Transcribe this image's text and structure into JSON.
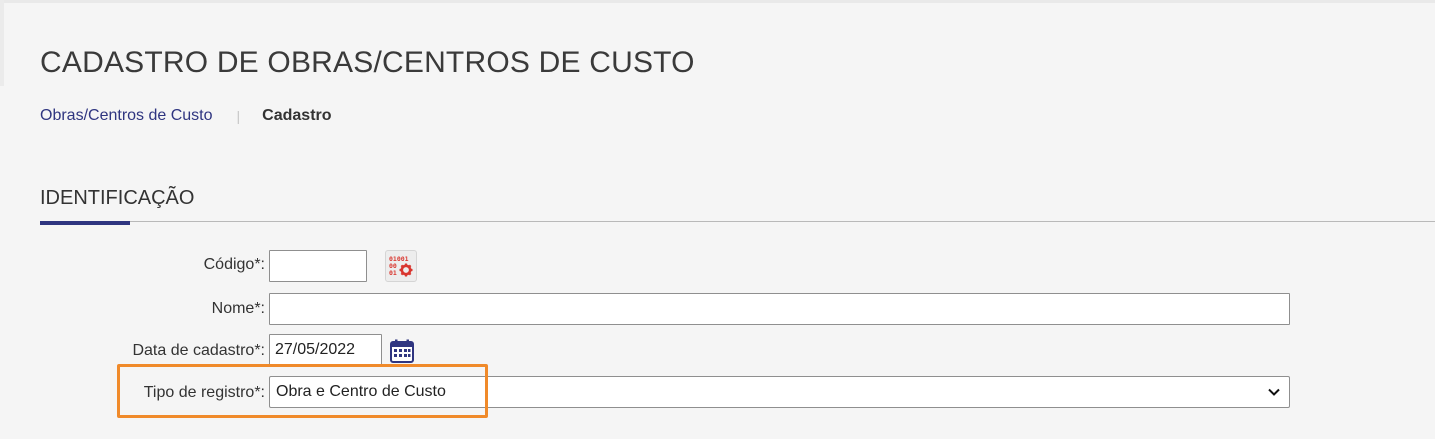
{
  "page": {
    "title": "CADASTRO DE OBRAS/CENTROS DE CUSTO"
  },
  "breadcrumb": {
    "parent": "Obras/Centros de Custo",
    "separator": "|",
    "current": "Cadastro"
  },
  "section": {
    "title": "IDENTIFICAÇÃO"
  },
  "form": {
    "codigo": {
      "label": "Código*:",
      "value": "",
      "generator_icon": "code-generator-icon"
    },
    "nome": {
      "label": "Nome*:",
      "value": ""
    },
    "data_cadastro": {
      "label": "Data de cadastro*:",
      "value": "27/05/2022",
      "calendar_icon": "calendar-icon"
    },
    "tipo_registro": {
      "label": "Tipo de registro*:",
      "selected": "Obra e Centro de Custo"
    }
  },
  "colors": {
    "accent": "#2f3580",
    "highlight": "#f08a2a",
    "icon_red": "#d9362f"
  }
}
